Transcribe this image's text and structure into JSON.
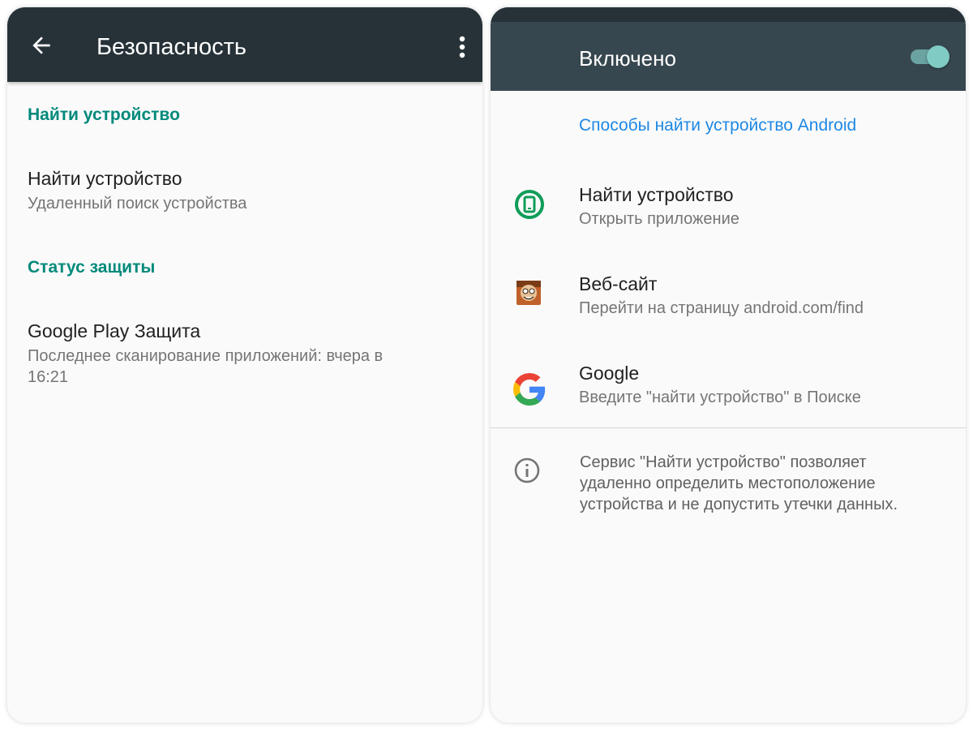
{
  "left": {
    "toolbar": {
      "title": "Безопасность"
    },
    "sections": [
      {
        "header": "Найти устройство",
        "item": {
          "title": "Найти устройство",
          "summary": "Удаленный поиск устройства"
        }
      },
      {
        "header": "Статус защиты",
        "item": {
          "title": "Google Play Защита",
          "summary_line1": "Последнее сканирование приложений: вчера в",
          "summary_line2": "16:21"
        }
      }
    ]
  },
  "right": {
    "switch": {
      "label": "Включено",
      "state": "on"
    },
    "ways_header": "Способы найти устройство Android",
    "items": [
      {
        "title": "Найти устройство",
        "summary": "Открыть приложение",
        "icon": "find-device-app-icon"
      },
      {
        "title": "Веб-сайт",
        "summary": "Перейти на страницу android.com/find",
        "icon": "website-favicon-icon"
      },
      {
        "title": "Google",
        "summary": "Введите \"найти устройство\" в Поиске",
        "icon": "google-icon"
      }
    ],
    "info": {
      "line1": "Сервис \"Найти устройство\" позволяет",
      "line2": "удаленно определить местоположение",
      "line3": "устройства и не допустить утечки данных."
    }
  },
  "colors": {
    "toolbar": "#263238",
    "switch_bar": "#37474f",
    "accent_teal": "#00897b",
    "link_blue": "#1e88e5",
    "toggle": "#80cbc4"
  }
}
